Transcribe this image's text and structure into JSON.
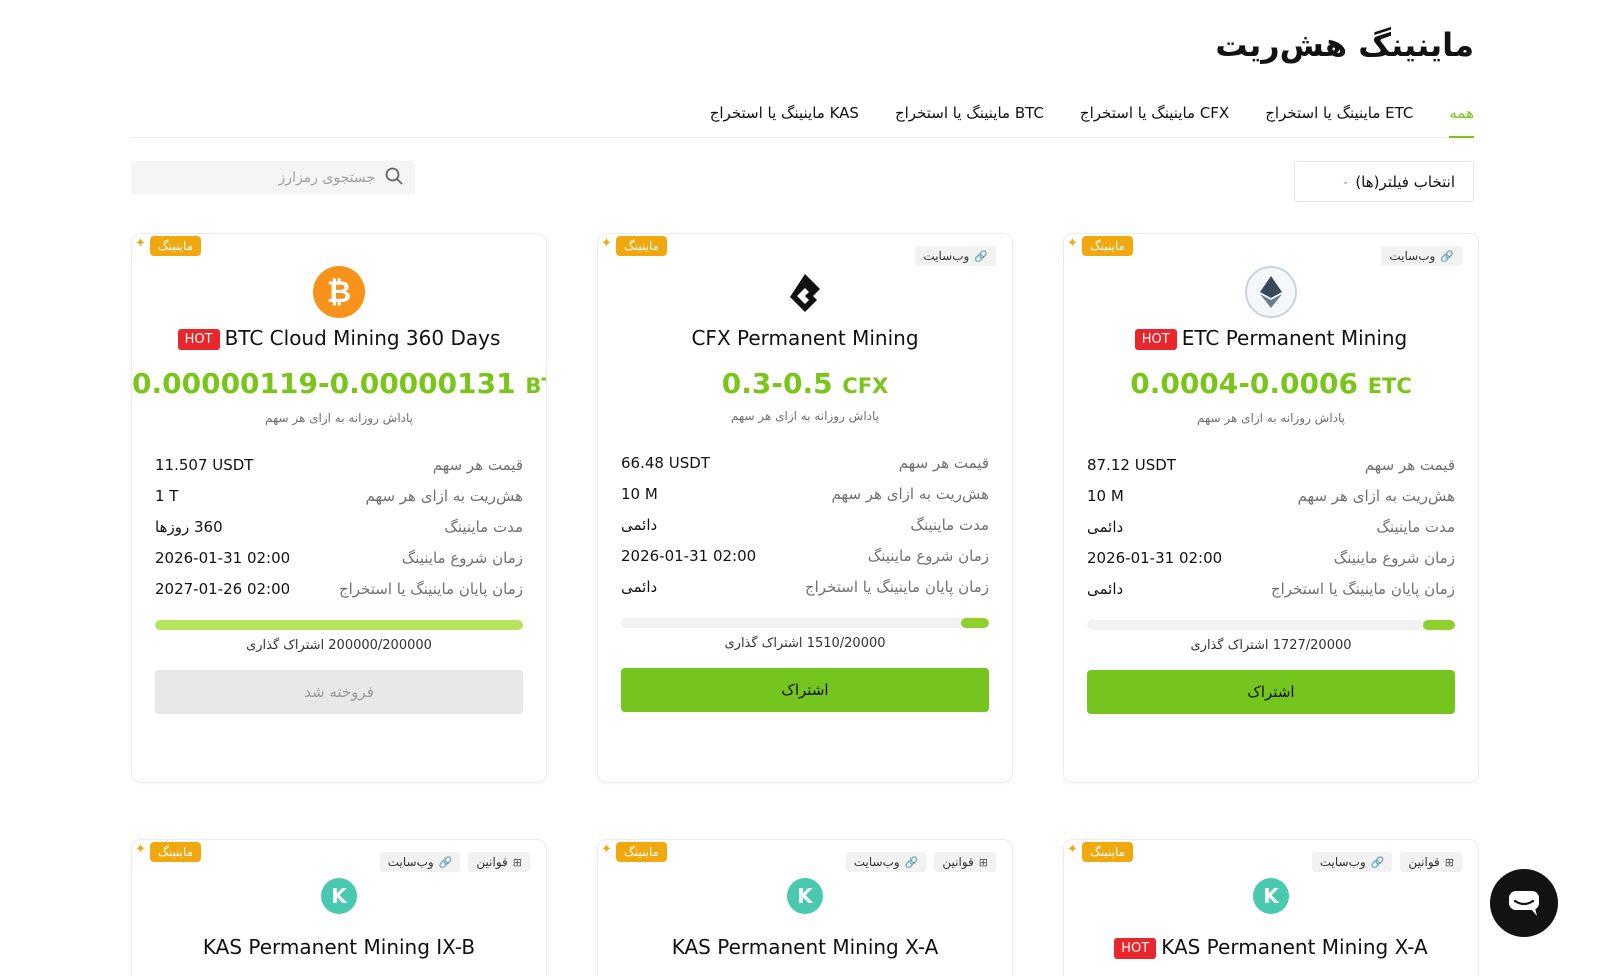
{
  "page": {
    "title": "ماینینگ هش‌ریت"
  },
  "tabs": [
    {
      "label": "همه"
    },
    {
      "label": "ETC ماینینگ یا استخراج"
    },
    {
      "label": "CFX ماینینگ یا استخراج"
    },
    {
      "label": "BTC ماینینگ یا استخراج"
    },
    {
      "label": "KAS ماینینگ یا استخراج"
    }
  ],
  "filter": {
    "label": "انتخاب فیلتر(ها)"
  },
  "search": {
    "placeholder": "جستجوی رمزارز"
  },
  "common": {
    "mining_badge": "ماینینگ",
    "website_chip": "وب‌سایت",
    "rules_chip": "قوانین",
    "hot": "HOT",
    "reward_sub": "پاداش روزانه به ازای هر سهم",
    "label_price": "قیمت هر سهم",
    "label_hashrate": "هش‌ریت به ازای هر سهم",
    "label_duration": "مدت ماینینگ",
    "label_start": "زمان شروع ماینینگ",
    "label_end": "زمان پایان ماینینگ یا استخراج"
  },
  "cards": [
    {
      "name": "BTC Cloud Mining 360 Days",
      "reward": "0.00000119-0.00000131",
      "unit": "BTC",
      "price": "11.507 USDT",
      "hashrate": "1 T",
      "duration": "360 روزها",
      "start": "2026-01-31 02:00",
      "end": "2027-01-26 02:00",
      "subscriptions": "200000/200000 اشتراک گذاری",
      "progress": 1.0,
      "button": "فروخته شد"
    },
    {
      "name": "CFX Permanent Mining",
      "reward": "0.3-0.5",
      "unit": "CFX",
      "price": "66.48 USDT",
      "hashrate": "10 M",
      "duration": "دائمی",
      "start": "2026-01-31 02:00",
      "end": "دائمی",
      "subscriptions": "1510/20000 اشتراک گذاری",
      "progress": 0.0755,
      "button": "اشتراک"
    },
    {
      "name": "ETC Permanent Mining",
      "reward": "0.0004-0.0006",
      "unit": "ETC",
      "price": "87.12 USDT",
      "hashrate": "10 M",
      "duration": "دائمی",
      "start": "2026-01-31 02:00",
      "end": "دائمی",
      "subscriptions": "1727/20000 اشتراک گذاری",
      "progress": 0.0864,
      "button": "اشتراک"
    },
    {
      "name": "KAS Permanent Mining IX-B"
    },
    {
      "name": "KAS Permanent Mining X-A"
    },
    {
      "name": "KAS Permanent Mining X-A"
    }
  ],
  "colors": {
    "accent": "#7ac51a",
    "hot": "#e8262b",
    "badge": "#f0a80e",
    "button": "#76c41e"
  }
}
